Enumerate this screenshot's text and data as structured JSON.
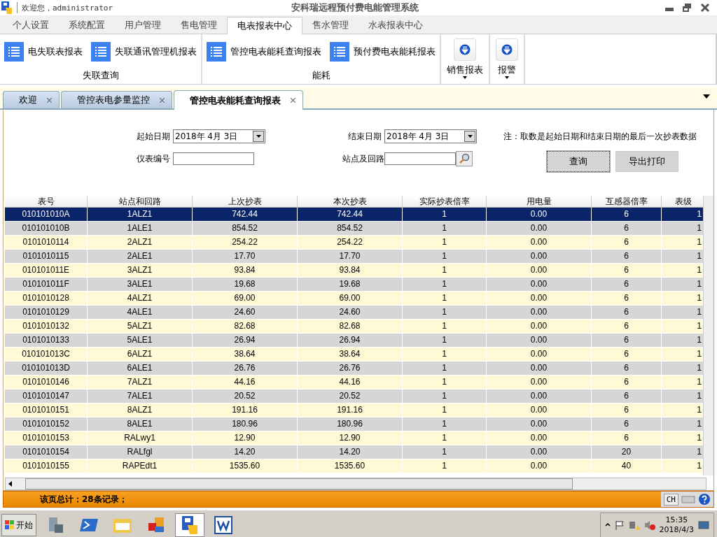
{
  "window": {
    "welcome": "欢迎您，administrator",
    "title": "安科瑞远程预付费电能管理系统"
  },
  "menu_tabs": [
    {
      "label": "个人设置",
      "selected": false
    },
    {
      "label": "系统配置",
      "selected": false
    },
    {
      "label": "用户管理",
      "selected": false
    },
    {
      "label": "售电管理",
      "selected": false
    },
    {
      "label": "电表报表中心",
      "selected": true
    },
    {
      "label": "售水管理",
      "selected": false
    },
    {
      "label": "水表报表中心",
      "selected": false
    }
  ],
  "ribbon": [
    {
      "kind": "list",
      "title": "失联查询",
      "items": [
        "电失联表报表",
        "失联通讯管理机报表"
      ]
    },
    {
      "kind": "list",
      "title": "能耗",
      "items": [
        "管控电表能耗查询报表",
        "预付费电表能耗报表"
      ]
    },
    {
      "kind": "dropdown",
      "items": [
        "销售报表"
      ]
    },
    {
      "kind": "dropdown",
      "items": [
        "报警"
      ]
    }
  ],
  "doc_tabs": [
    {
      "label": "欢迎",
      "selected": false
    },
    {
      "label": "管控表电参量监控",
      "selected": false
    },
    {
      "label": "管控电表能耗查询报表",
      "selected": true
    }
  ],
  "filters": {
    "start_label": "起始日期",
    "start_value": "2018年  4月  3日",
    "end_label": "结束日期",
    "end_value": "2018年  4月  3日",
    "meter_label": "仪表编号",
    "station_label": "站点及回路",
    "note": "注：取数是起始日期和结束日期的最后一次抄表数据",
    "query_button": "查询",
    "export_button": "导出打印"
  },
  "table": {
    "columns": [
      "表号",
      "站点和回路",
      "上次抄表",
      "本次抄表",
      "实际抄表倍率",
      "用电量",
      "互感器倍率",
      "表级"
    ],
    "rows": [
      {
        "selected": true,
        "cells": [
          "010101010A",
          "1ALZ1",
          "742.44",
          "742.44",
          "1",
          "0.00",
          "6",
          "1"
        ]
      },
      {
        "selected": false,
        "cells": [
          "010101010B",
          "1ALE1",
          "854.52",
          "854.52",
          "1",
          "0.00",
          "6",
          "1"
        ]
      },
      {
        "selected": false,
        "cells": [
          "0101010114",
          "2ALZ1",
          "254.22",
          "254.22",
          "1",
          "0.00",
          "6",
          "1"
        ]
      },
      {
        "selected": false,
        "cells": [
          "0101010115",
          "2ALE1",
          "17.70",
          "17.70",
          "1",
          "0.00",
          "6",
          "1"
        ]
      },
      {
        "selected": false,
        "cells": [
          "010101011E",
          "3ALZ1",
          "93.84",
          "93.84",
          "1",
          "0.00",
          "6",
          "1"
        ]
      },
      {
        "selected": false,
        "cells": [
          "010101011F",
          "3ALE1",
          "19.68",
          "19.68",
          "1",
          "0.00",
          "6",
          "1"
        ]
      },
      {
        "selected": false,
        "cells": [
          "0101010128",
          "4ALZ1",
          "69.00",
          "69.00",
          "1",
          "0.00",
          "6",
          "1"
        ]
      },
      {
        "selected": false,
        "cells": [
          "0101010129",
          "4ALE1",
          "24.60",
          "24.60",
          "1",
          "0.00",
          "6",
          "1"
        ]
      },
      {
        "selected": false,
        "cells": [
          "0101010132",
          "5ALZ1",
          "82.68",
          "82.68",
          "1",
          "0.00",
          "6",
          "1"
        ]
      },
      {
        "selected": false,
        "cells": [
          "0101010133",
          "5ALE1",
          "26.94",
          "26.94",
          "1",
          "0.00",
          "6",
          "1"
        ]
      },
      {
        "selected": false,
        "cells": [
          "010101013C",
          "6ALZ1",
          "38.64",
          "38.64",
          "1",
          "0.00",
          "6",
          "1"
        ]
      },
      {
        "selected": false,
        "cells": [
          "010101013D",
          "6ALE1",
          "26.76",
          "26.76",
          "1",
          "0.00",
          "6",
          "1"
        ]
      },
      {
        "selected": false,
        "cells": [
          "0101010146",
          "7ALZ1",
          "44.16",
          "44.16",
          "1",
          "0.00",
          "6",
          "1"
        ]
      },
      {
        "selected": false,
        "cells": [
          "0101010147",
          "7ALE1",
          "20.52",
          "20.52",
          "1",
          "0.00",
          "6",
          "1"
        ]
      },
      {
        "selected": false,
        "cells": [
          "0101010151",
          "8ALZ1",
          "191.16",
          "191.16",
          "1",
          "0.00",
          "6",
          "1"
        ]
      },
      {
        "selected": false,
        "cells": [
          "0101010152",
          "8ALE1",
          "180.96",
          "180.96",
          "1",
          "0.00",
          "6",
          "1"
        ]
      },
      {
        "selected": false,
        "cells": [
          "0101010153",
          "RALwy1",
          "12.90",
          "12.90",
          "1",
          "0.00",
          "6",
          "1"
        ]
      },
      {
        "selected": false,
        "cells": [
          "0101010154",
          "RALfgl",
          "14.20",
          "14.20",
          "1",
          "0.00",
          "20",
          "1"
        ]
      },
      {
        "selected": false,
        "cells": [
          "0101010155",
          "RAPEdt1",
          "1535.60",
          "1535.60",
          "1",
          "0.00",
          "40",
          "1"
        ]
      }
    ]
  },
  "status_bar": {
    "summary": "该页总计：28条记录；",
    "ime": "CH"
  },
  "taskbar": {
    "start": "开始",
    "time": "15:35",
    "date": "2018/4/3"
  }
}
